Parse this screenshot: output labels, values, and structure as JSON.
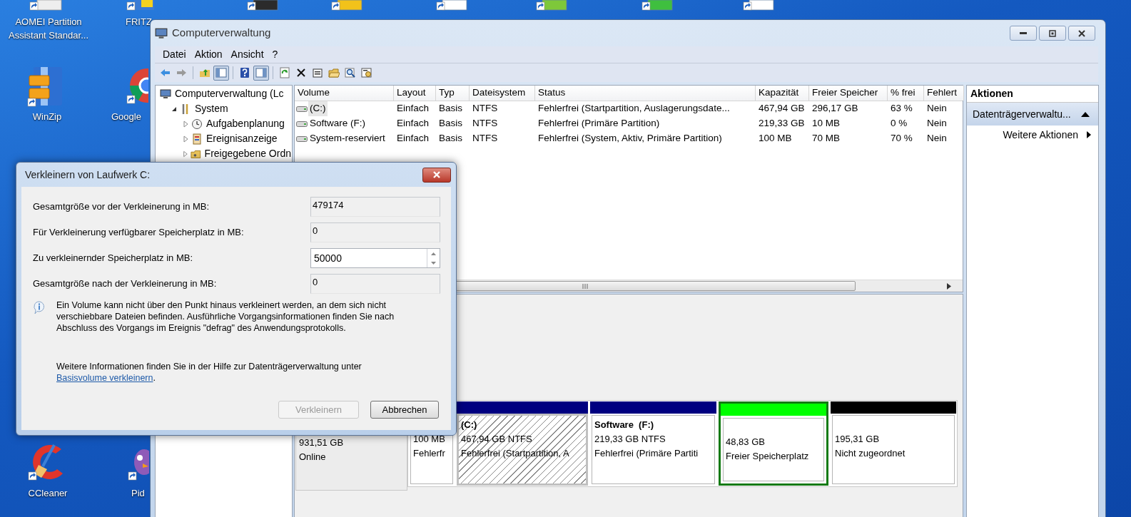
{
  "desktop": {
    "icons": [
      {
        "label": "AOMEI Partition Assistant Standar..."
      },
      {
        "label": "FRITZ"
      },
      {
        "label": "WinZip"
      },
      {
        "label": "Google"
      },
      {
        "label": "CCleaner"
      },
      {
        "label": "Pid"
      }
    ]
  },
  "window": {
    "title": "Computerverwaltung",
    "menu": [
      "Datei",
      "Aktion",
      "Ansicht",
      "?"
    ],
    "toolbar": [
      {
        "kind": "back",
        "pressed": false
      },
      {
        "kind": "forward",
        "pressed": false
      },
      {
        "kind": "separator"
      },
      {
        "kind": "up",
        "pressed": false
      },
      {
        "kind": "tree",
        "pressed": true
      },
      {
        "kind": "separator"
      },
      {
        "kind": "help",
        "pressed": false
      },
      {
        "kind": "panel",
        "pressed": true
      },
      {
        "kind": "separator"
      },
      {
        "kind": "refresh",
        "pressed": false
      },
      {
        "kind": "delete",
        "pressed": false
      },
      {
        "kind": "properties",
        "pressed": false
      },
      {
        "kind": "open",
        "pressed": false
      },
      {
        "kind": "search",
        "pressed": false
      },
      {
        "kind": "settings",
        "pressed": false
      }
    ],
    "tree": [
      {
        "label": "Computerverwaltung (Lc",
        "kind": "computer",
        "children": [
          {
            "label": "System",
            "kind": "tools",
            "expanded": true,
            "children": [
              {
                "label": "Aufgabenplanung",
                "kind": "clock",
                "expanded": false
              },
              {
                "label": "Ereignisanzeige",
                "kind": "events",
                "expanded": false
              },
              {
                "label": "Freigegebene Ordn",
                "kind": "shared",
                "expanded": false
              }
            ]
          }
        ]
      }
    ],
    "table": {
      "columns": [
        "Volume",
        "Layout",
        "Typ",
        "Dateisystem",
        "Status",
        "Kapazität",
        "Freier Speicher",
        "% frei",
        "Fehlert"
      ],
      "rows": [
        {
          "selected": true,
          "cells": [
            "(C:)",
            "Einfach",
            "Basis",
            "NTFS",
            "Fehlerfrei (Startpartition, Auslagerungsdate...",
            "467,94 GB",
            "296,17 GB",
            "63 %",
            "Nein"
          ]
        },
        {
          "selected": false,
          "cells": [
            "Software (F:)",
            "Einfach",
            "Basis",
            "NTFS",
            "Fehlerfrei (Primäre Partition)",
            "219,33 GB",
            "10 MB",
            "0 %",
            "Nein"
          ]
        },
        {
          "selected": false,
          "cells": [
            "System-reserviert",
            "Einfach",
            "Basis",
            "NTFS",
            "Fehlerfrei (System, Aktiv, Primäre Partition)",
            "100 MB",
            "70 MB",
            "70 %",
            "Nein"
          ]
        }
      ]
    },
    "disk": {
      "size": "931,51 GB",
      "status": "Online",
      "partitions": [
        {
          "kind": "primary",
          "selected": false,
          "lines": [
            "100 MB",
            "Fehlerfr"
          ]
        },
        {
          "kind": "primary",
          "selected": true,
          "color": "#000080",
          "title": "(C:)",
          "lines": [
            "467,94 GB NTFS",
            "Fehlerfrei (Startpartition, A"
          ]
        },
        {
          "kind": "primary",
          "selected": false,
          "color": "#000080",
          "title": "Software  (F:)",
          "lines": [
            "219,33 GB NTFS",
            "Fehlerfrei (Primäre Partiti"
          ]
        },
        {
          "kind": "free",
          "selected": false,
          "color": "#00ff00",
          "lines": [
            "48,83 GB",
            "Freier Speicherplatz"
          ]
        },
        {
          "kind": "unallocated",
          "selected": false,
          "color": "#000000",
          "lines": [
            "195,31 GB",
            "Nicht zugeordnet"
          ]
        }
      ]
    },
    "actions": {
      "title": "Aktionen",
      "section": {
        "label": "Datenträgerverwaltu...",
        "expanded": true
      },
      "items": [
        "Weitere Aktionen"
      ]
    }
  },
  "dialog": {
    "title": "Verkleinern von Laufwerk C:",
    "fields": [
      {
        "kind": "readonly",
        "label": "Gesamtgröße vor der Verkleinerung in MB:",
        "value": "479174"
      },
      {
        "kind": "readonly",
        "label": "Für Verkleinerung verfügbarer Speicherplatz in MB:",
        "value": "0"
      },
      {
        "kind": "spinner",
        "label": "Zu verkleinernder Speicherplatz in MB:",
        "value": "50000"
      },
      {
        "kind": "readonly",
        "label": "Gesamtgröße nach der Verkleinerung in MB:",
        "value": "0"
      }
    ],
    "info": "Ein Volume kann nicht über den Punkt hinaus verkleinert werden, an dem sich nicht verschiebbare Dateien befinden. Ausführliche Vorgangsinformationen finden Sie nach Abschluss des Vorgangs im Ereignis \"defrag\" des Anwendungsprotokolls.",
    "more_info": {
      "text": "Weitere Informationen finden Sie in der Hilfe zur Datenträgerverwaltung unter",
      "link": "Basisvolume verkleinern",
      "suffix": "."
    },
    "buttons": [
      {
        "label": "Verkleinern",
        "disabled": true
      },
      {
        "label": "Abbrechen",
        "disabled": false
      }
    ]
  }
}
